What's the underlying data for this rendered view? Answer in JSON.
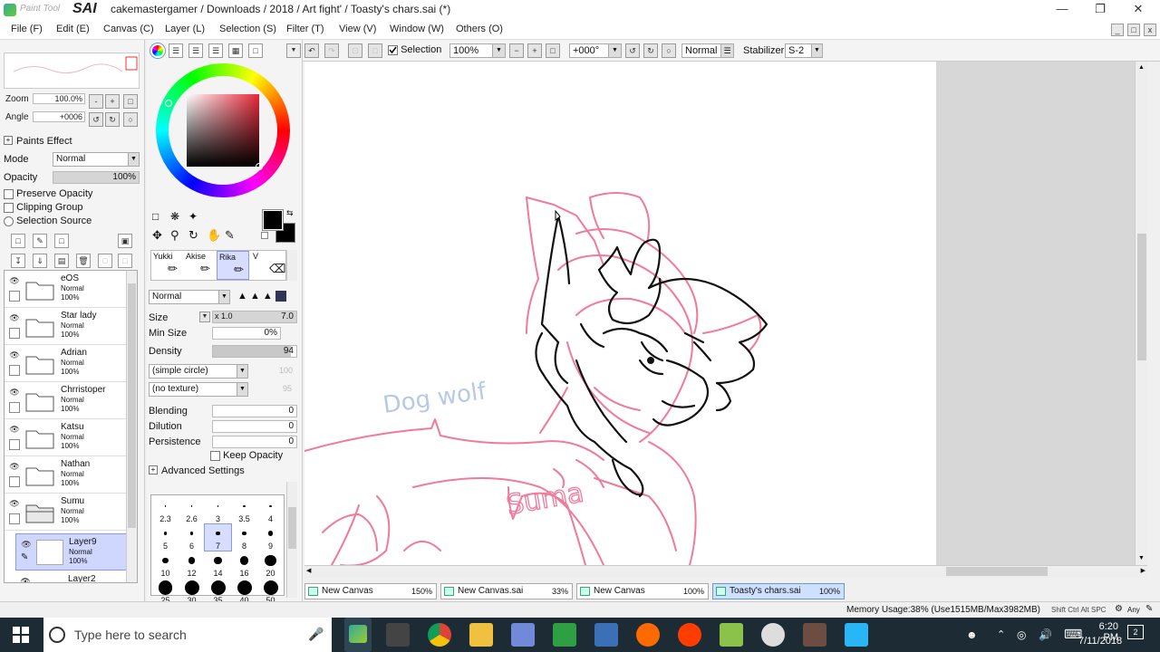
{
  "window": {
    "app_name_small": "Paint Tool",
    "app_name": "SAI",
    "title": "cakemastergamer / Downloads / 2018 / Art fight' / Toasty's chars.sai (*)"
  },
  "menu": [
    {
      "label": "File (F)"
    },
    {
      "label": "Edit (E)"
    },
    {
      "label": "Canvas (C)"
    },
    {
      "label": "Layer (L)"
    },
    {
      "label": "Selection (S)"
    },
    {
      "label": "Filter (T)"
    },
    {
      "label": "View (V)"
    },
    {
      "label": "Window (W)"
    },
    {
      "label": "Others (O)"
    }
  ],
  "navigator": {
    "zoom_label": "Zoom",
    "zoom_value": "100.0%",
    "angle_label": "Angle",
    "angle_value": "+0006"
  },
  "paints_effect": {
    "header": "Paints Effect",
    "mode_label": "Mode",
    "mode_value": "Normal",
    "opacity_label": "Opacity",
    "opacity_value": "100%",
    "preserve_opacity": "Preserve Opacity",
    "clipping_group": "Clipping Group",
    "selection_source": "Selection Source"
  },
  "layers": [
    {
      "name": "eOS",
      "mode": "Normal",
      "pct": "100%",
      "type": "folder"
    },
    {
      "name": "Star lady",
      "mode": "Normal",
      "pct": "100%",
      "type": "folder"
    },
    {
      "name": "Adrian",
      "mode": "Normal",
      "pct": "100%",
      "type": "folder"
    },
    {
      "name": "Chrristoper",
      "mode": "Normal",
      "pct": "100%",
      "type": "folder"
    },
    {
      "name": "Katsu",
      "mode": "Normal",
      "pct": "100%",
      "type": "folder"
    },
    {
      "name": "Nathan",
      "mode": "Normal",
      "pct": "100%",
      "type": "folder"
    },
    {
      "name": "Sumu",
      "mode": "Normal",
      "pct": "100%",
      "type": "folder"
    },
    {
      "name": "Layer9",
      "mode": "Normal",
      "pct": "100%",
      "type": "layer",
      "selected": true
    },
    {
      "name": "Layer2",
      "mode": "",
      "pct": "",
      "type": "layer"
    }
  ],
  "brush_tools": {
    "tool1": "Yukki",
    "tool2": "Akise",
    "tool3": "Rika",
    "tool4": "V",
    "blend_mode": "Normal",
    "size_label": "Size",
    "size_mult": "x 1.0",
    "size_value": "7.0",
    "min_size_label": "Min Size",
    "min_size_value": "0%",
    "density_label": "Density",
    "density_value": "94",
    "density_level": 0.94,
    "shape": "(simple circle)",
    "shape_value": "100",
    "texture": "(no texture)",
    "texture_value": "95",
    "blending_label": "Blending",
    "blending_value": "0",
    "dilution_label": "Dilution",
    "dilution_value": "0",
    "persistence_label": "Persistence",
    "persistence_value": "0",
    "keep_opacity": "Keep Opacity",
    "advanced": "Advanced Settings"
  },
  "brush_sizes": [
    "2.3",
    "2.6",
    "3",
    "3.5",
    "4",
    "5",
    "6",
    "7",
    "8",
    "9",
    "10",
    "12",
    "14",
    "16",
    "20",
    "25",
    "30",
    "35",
    "40",
    "50"
  ],
  "canvas_toolbar": {
    "selection_label": "Selection",
    "zoom": "100%",
    "angle": "+000°",
    "blend": "Normal",
    "stabilizer_label": "Stabilizer",
    "stabilizer_value": "S-2"
  },
  "canvas_text": {
    "dog_wolf": "Dog wolf",
    "suma": "Suma"
  },
  "tabs": [
    {
      "label": "New Canvas",
      "pct": "150%"
    },
    {
      "label": "New Canvas.sai",
      "pct": "33%"
    },
    {
      "label": "New Canvas",
      "pct": "100%"
    },
    {
      "label": "Toasty's chars.sai",
      "pct": "100%",
      "active": true
    }
  ],
  "status": {
    "memory": "Memory Usage:38% (Use1515MB/Max3982MB)",
    "keys": "Shift Ctrl Alt SPC",
    "any": "Any"
  },
  "taskbar": {
    "search_placeholder": "Type here to search",
    "time": "6:20 PM",
    "date": "7/11/2018",
    "notifications": "2"
  },
  "colors": {
    "sketch_pink": "#f07a9a",
    "line_black": "#111111",
    "selected_layer": "#cfd7ff",
    "taskbar": "#1d2b34"
  }
}
